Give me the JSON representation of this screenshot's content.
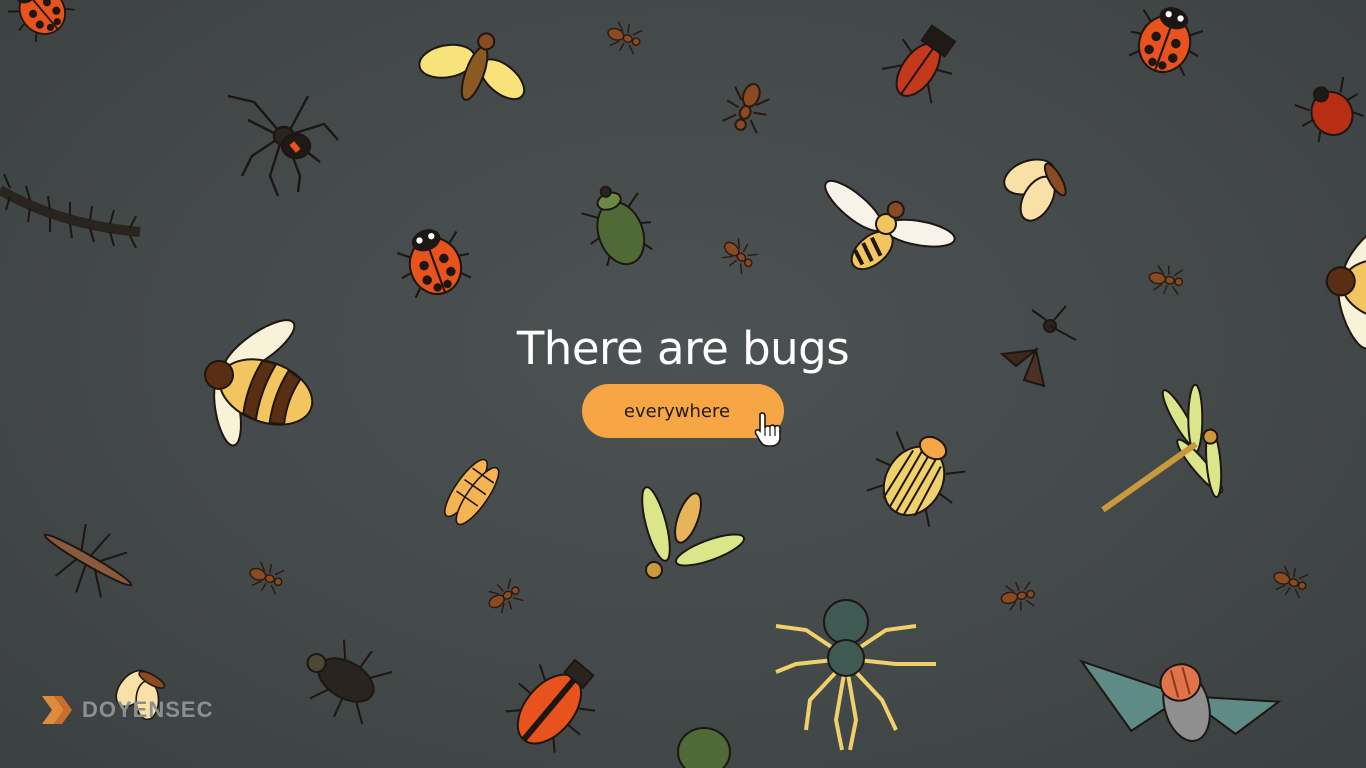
{
  "hero": {
    "headline": "There are bugs",
    "cta_label": "everywhere"
  },
  "brand": {
    "logo_text": "DOYENSEC"
  },
  "colors": {
    "background": "#474c4d",
    "accent": "#f7a645",
    "headline": "#ffffff"
  },
  "icons": {
    "cursor": "hand-pointer-icon",
    "logo": "doyensec-chevron-icon"
  }
}
